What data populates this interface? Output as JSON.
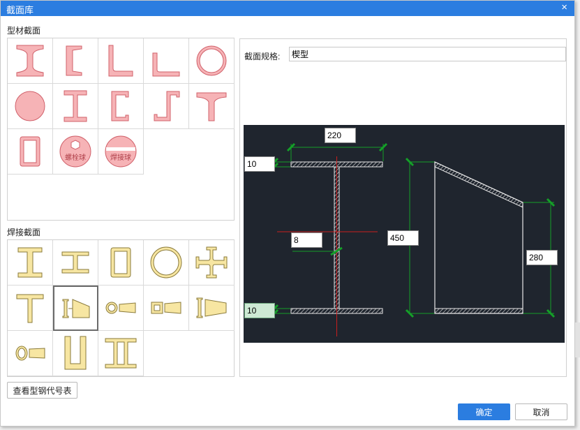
{
  "window": {
    "title": "截面库",
    "close_glyph": "×"
  },
  "profile_section": {
    "label": "型材截面",
    "items": [
      "工字钢",
      "槽钢",
      "等边角钢",
      "不等边角钢",
      "圆管",
      "圆钢",
      "H型钢",
      "C型钢",
      "Z型钢",
      "T型钢",
      "矩形管",
      "螺栓球",
      "焊接球"
    ],
    "bolt_ball_label": "螺栓球",
    "weld_ball_label": "焊接球"
  },
  "welded_section": {
    "label": "焊接截面",
    "items": [
      "焊接工字形",
      "焊接H形",
      "焊接箱形",
      "焊接圆管",
      "十字形",
      "焊接T形",
      "楔型",
      "圆管锥形",
      "箱形锥形",
      "工字锥形",
      "圆锥形",
      "U形",
      "双槽形"
    ],
    "selected": "楔型"
  },
  "spec": {
    "label": "截面规格:",
    "value": "楔型"
  },
  "dimensions": {
    "flange_width": "220",
    "top_flange_thickness": "10",
    "web_thickness": "8",
    "height_left": "450",
    "height_right": "280",
    "bottom_flange_thickness": "10"
  },
  "buttons": {
    "view_table": "查看型钢代号表",
    "ok": "确定",
    "cancel": "取消"
  },
  "colors": {
    "title_bar": "#2b7de0",
    "profile_fill": "#f6b3b6",
    "profile_stroke": "#d0606a",
    "welded_fill": "#f7e6a2",
    "welded_stroke": "#8a7a3a",
    "drawing_bg": "#1f252e",
    "dim_green": "#14a028",
    "center_red": "#c81e1e"
  }
}
